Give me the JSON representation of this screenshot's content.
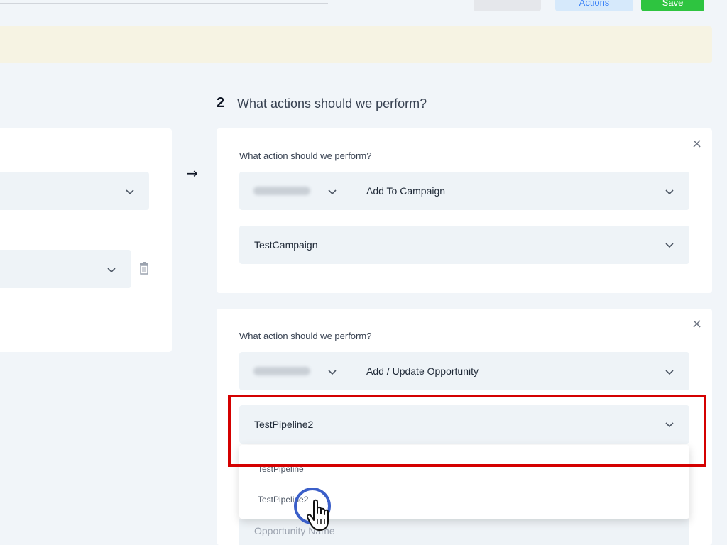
{
  "toolbar": {
    "actions_label": "Actions",
    "save_label": "Save"
  },
  "step": {
    "number": "2",
    "title": "What actions should we perform?"
  },
  "actions": [
    {
      "label": "What action should we perform?",
      "action_value": "Add To Campaign",
      "sub_value": "TestCampaign"
    },
    {
      "label": "What action should we perform?",
      "action_value": "Add / Update Opportunity",
      "sub_value": "TestPipeline2"
    }
  ],
  "dropdown": {
    "options": [
      "TestPipeline",
      "TestPipeline2"
    ]
  },
  "opportunity_field": {
    "placeholder": "Opportunity Name"
  },
  "icons": {
    "close": "close-icon",
    "chevron": "chevron-down-icon",
    "arrow": "arrow-right-icon",
    "trash": "trash-icon",
    "cursor": "hand-pointer-icon"
  },
  "colors": {
    "highlight": "#d40000",
    "save": "#2ec440",
    "cursor_ring": "#3b5fc9"
  }
}
